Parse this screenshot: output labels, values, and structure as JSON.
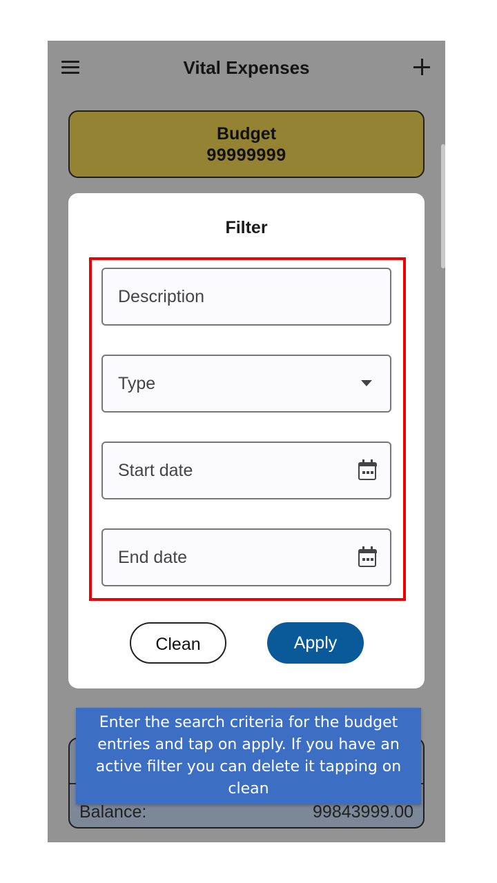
{
  "app": {
    "title": "Vital Expenses",
    "menu_icon": "hamburger-menu-icon",
    "add_icon": "plus-icon"
  },
  "budget": {
    "label": "Budget",
    "value": "99999999"
  },
  "summary": {
    "balance_label": "Balance:",
    "balance_value": "99843999.00"
  },
  "filter_dialog": {
    "title": "Filter",
    "fields": {
      "description": {
        "placeholder": "Description"
      },
      "type": {
        "placeholder": "Type",
        "icon": "dropdown-arrow-icon"
      },
      "start_date": {
        "placeholder": "Start date",
        "icon": "calendar-icon"
      },
      "end_date": {
        "placeholder": "End date",
        "icon": "calendar-icon"
      }
    },
    "buttons": {
      "clean": "Clean",
      "apply": "Apply"
    }
  },
  "tooltip": {
    "text": "Enter the search criteria for the budget entries and tap on apply. If you have an active filter you can delete it tapping on clean"
  },
  "colors": {
    "overlay": "#939393",
    "budget_card": "#948332",
    "apply_button": "#0a5a9a",
    "highlight": "#ee0000",
    "tooltip": "#3c6fc4"
  }
}
